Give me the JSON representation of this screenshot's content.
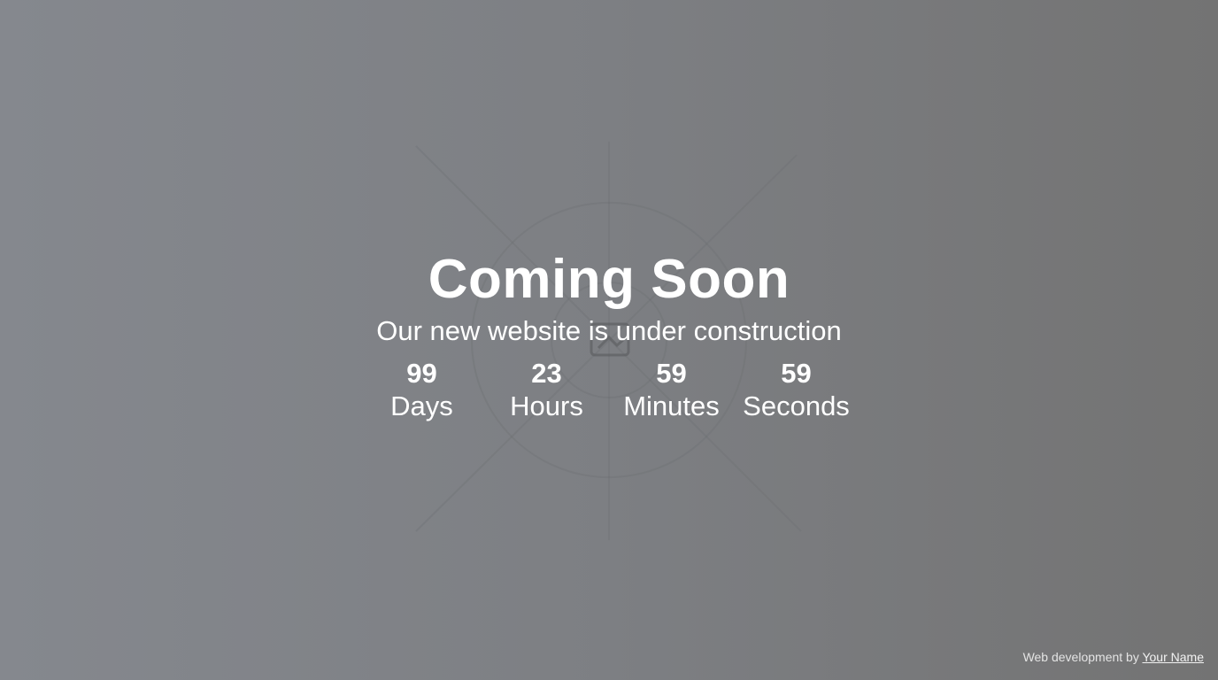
{
  "hero": {
    "title": "Coming Soon",
    "subtitle": "Our new website is under construction"
  },
  "countdown": [
    {
      "value": "99",
      "label": "Days"
    },
    {
      "value": "23",
      "label": "Hours"
    },
    {
      "value": "59",
      "label": "Minutes"
    },
    {
      "value": "59",
      "label": "Seconds"
    }
  ],
  "footer": {
    "credit_prefix": "Web development by",
    "credit_link": "Your Name"
  },
  "background": {
    "icon": "broken-image-icon",
    "gradient_start": "#85888e",
    "gradient_end": "#737373"
  }
}
